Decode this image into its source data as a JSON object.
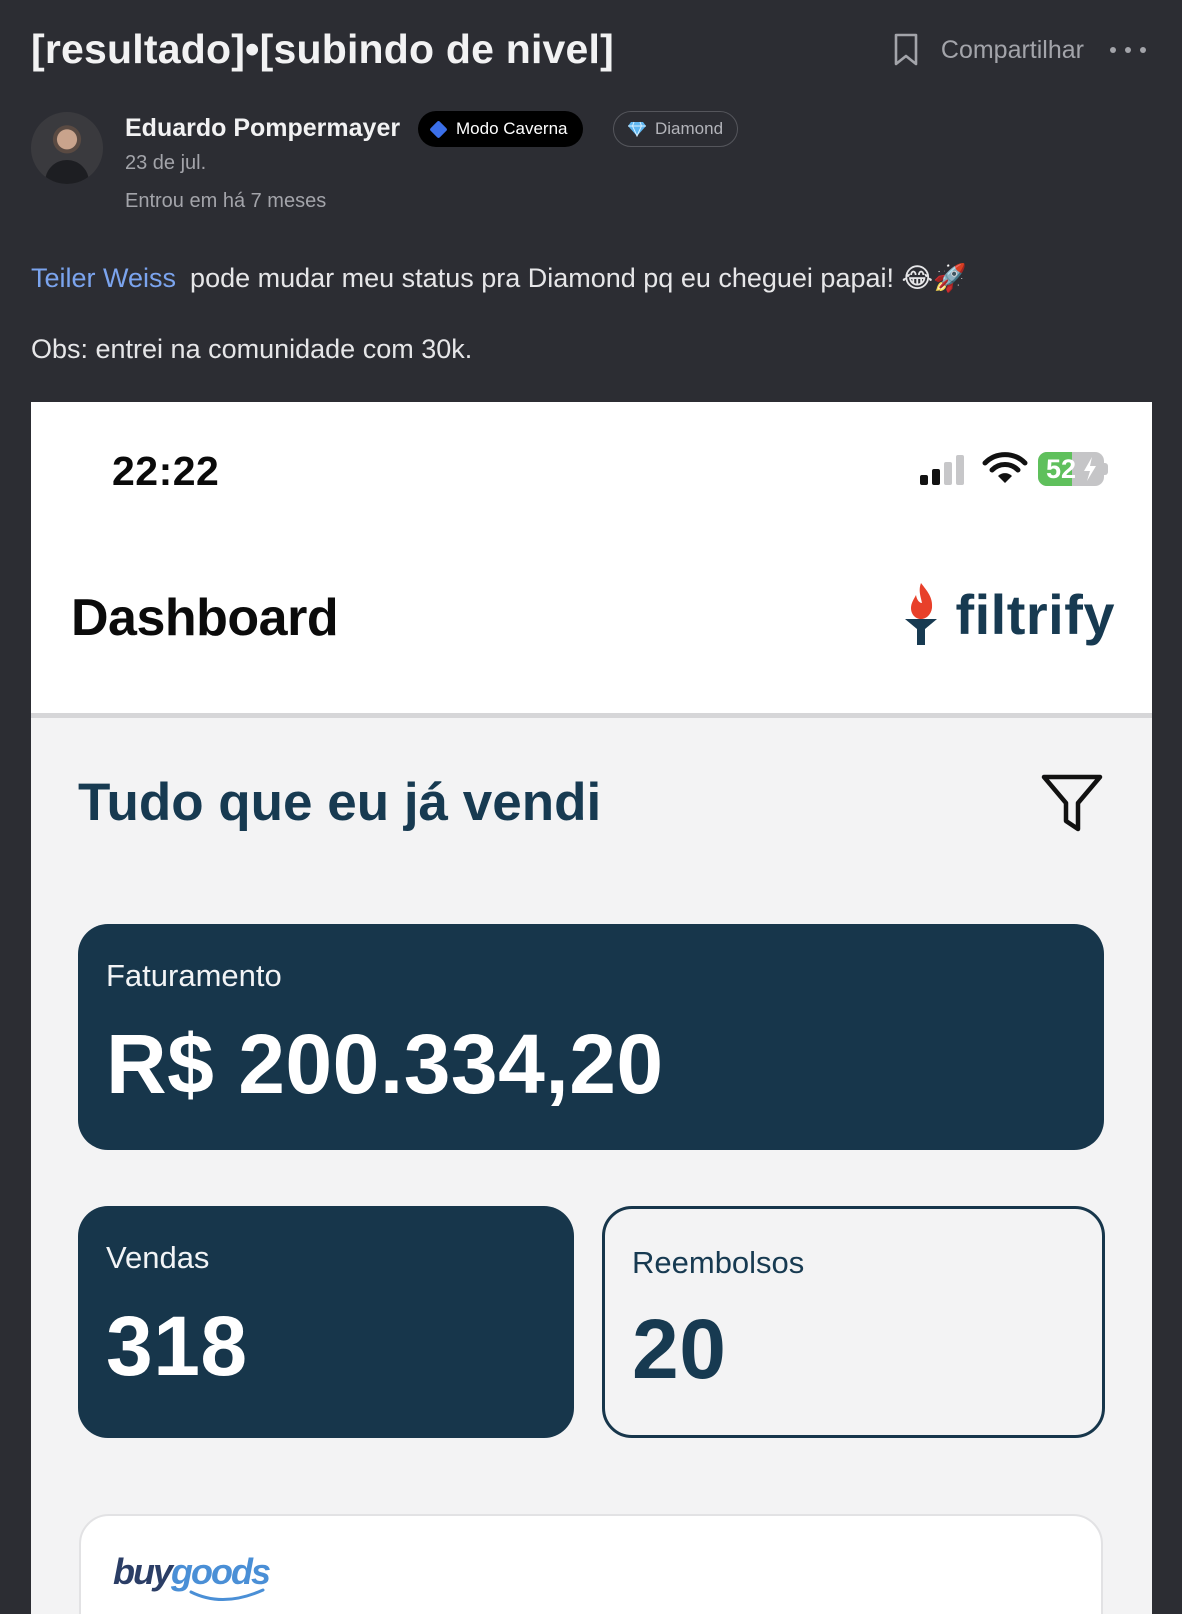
{
  "post": {
    "title": "[resultado]•[subindo de nivel]",
    "share_label": "Compartilhar",
    "author": {
      "name": "Eduardo Pompermayer",
      "badges": [
        {
          "label": "Modo Caverna",
          "icon": "blue-diamond-icon"
        },
        {
          "label": "Diamond",
          "icon": "gem-icon"
        }
      ],
      "date": "23 de jul.",
      "joined": "Entrou em há 7 meses"
    },
    "body": {
      "mention": "Teiler Weiss",
      "line1": "pode mudar meu status pra Diamond pq eu cheguei papai! 😂🚀",
      "line2": "Obs: entrei na comunidade com 30k."
    }
  },
  "screenshot": {
    "status_bar": {
      "time": "22:22",
      "battery_percent": "52",
      "battery_level": 0.52
    },
    "header": {
      "title": "Dashboard",
      "brand": "filtrify"
    },
    "section_title": "Tudo que eu já vendi",
    "cards": {
      "faturamento": {
        "label": "Faturamento",
        "value": "R$ 200.334,20"
      },
      "vendas": {
        "label": "Vendas",
        "value": "318"
      },
      "reembolsos": {
        "label": "Reembolsos",
        "value": "20"
      }
    },
    "platform_logo": "buygoods"
  },
  "colors": {
    "page_bg": "#2c2d33",
    "mention": "#7ba4ee",
    "card_dark": "#17364b",
    "brand_text": "#173a51",
    "torch_flame": "#e8402a"
  }
}
